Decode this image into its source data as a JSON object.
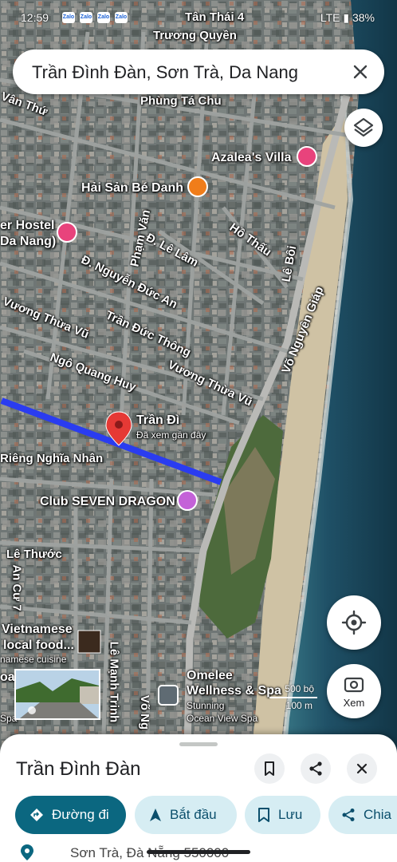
{
  "status_bar": {
    "time": "12:59",
    "right_text": "LTE ▮ 38%",
    "apps": [
      "Zalo",
      "Zalo",
      "Zalo",
      "Zalo"
    ]
  },
  "search": {
    "query": "Trần Đình Đàn, Sơn Trà, Da Nang",
    "clear_icon": "close-icon"
  },
  "map": {
    "streets": [
      "Tân Thái 4",
      "Trương Quyền",
      "Vân Thứ",
      "Phùng Tá Chu",
      "Phạm Văn",
      "Đ. Lê Lâm",
      "Hồ Thấu",
      "Lê Bôi",
      "Đ. Nguyễn Đức An",
      "Vương Thừa Vũ",
      "Trần Đức Thông",
      "Võ Nguyên Giáp",
      "Ngô Quang Huy",
      "Vương Thừa Vũ",
      "Riêng Nghĩa Nhân",
      "Lê Thước",
      "An Cư 7",
      "Lê Mạnh Trinh",
      "Võ Ng"
    ],
    "pois": {
      "azalea": "Azalea's Villa",
      "haisan": "Hải Sản Bé Danh",
      "hostel_1": "er Hostel",
      "hostel_2": "Da Nang)",
      "club": "Club SEVEN DRAGON",
      "viet_1": "Vietnamese",
      "viet_2": "local food...",
      "viet_3": "namese cuisine",
      "omelee_1": "Omelee",
      "omelee_2": "Wellness & Spa",
      "omelee_3": "Stunning",
      "omelee_4": "Ocean View Spa",
      "qa": "oa",
      "spa": "Spa"
    },
    "selected_pin": {
      "name": "Trần Đì",
      "note": "Đã xem gần đây"
    },
    "route_color": "#2a3cf0",
    "pin_color": "#e53935"
  },
  "scale": {
    "top": "500 bộ",
    "bottom": "100 m"
  },
  "buttons": {
    "layers_icon": "layers-icon",
    "location_icon": "my-location-icon",
    "xem_label": "Xem"
  },
  "sheet": {
    "title": "Trần Đình Đàn",
    "chips": [
      {
        "label": "Đường đi",
        "icon": "directions-icon"
      },
      {
        "label": "Bắt đầu",
        "icon": "navigation-icon"
      },
      {
        "label": "Lưu",
        "icon": "bookmark-icon"
      },
      {
        "label": "Chia",
        "icon": "share-icon"
      }
    ],
    "address": "Sơn Trà, Đà Nẵng 550000"
  }
}
